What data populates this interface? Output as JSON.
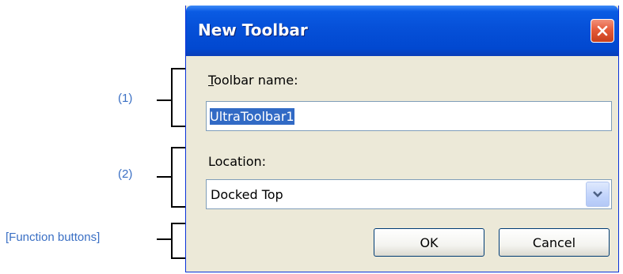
{
  "annotations": {
    "callout_1": "(1)",
    "callout_2": "(2)",
    "callout_function": "[Function buttons]"
  },
  "dialog": {
    "title": "New Toolbar",
    "close_icon": "close-x-icon",
    "toolbar_name_label": "Toolbar name:",
    "toolbar_name_mnemonic": "T",
    "toolbar_name_value": "UltraToolbar1",
    "location_label": "Location:",
    "location_value": "Docked Top",
    "dropdown_icon": "chevron-down-icon",
    "ok_label": "OK",
    "cancel_label": "Cancel"
  },
  "colors": {
    "titlebar": "#0650d8",
    "close_button": "#e55b3a",
    "selection": "#316ac5",
    "annotation_text": "#3a6fc4"
  }
}
